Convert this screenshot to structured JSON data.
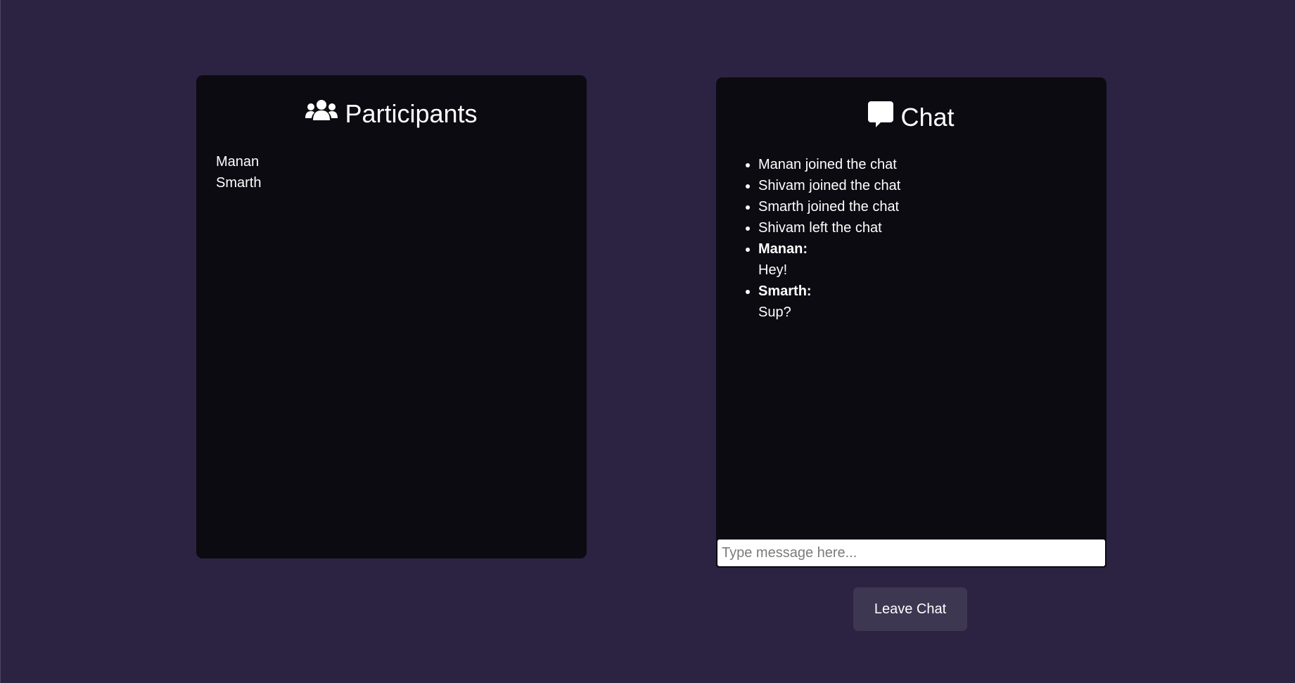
{
  "participants": {
    "title": "Participants",
    "icon": "users-icon",
    "names": [
      "Manan",
      "Smarth"
    ]
  },
  "chat": {
    "title": "Chat",
    "icon": "comment-icon",
    "events": [
      "Manan joined the chat",
      "Shivam joined the chat",
      "Smarth joined the chat",
      "Shivam left the chat"
    ],
    "messages": [
      {
        "sender": "Manan:",
        "text": "Hey!"
      },
      {
        "sender": "Smarth:",
        "text": "Sup?"
      }
    ],
    "input_placeholder": "Type message here...",
    "input_value": ""
  },
  "actions": {
    "leave_label": "Leave Chat"
  },
  "colors": {
    "background": "#2c2342",
    "panel": "#0c0b12",
    "button": "#3d3752",
    "text": "#ffffff"
  }
}
